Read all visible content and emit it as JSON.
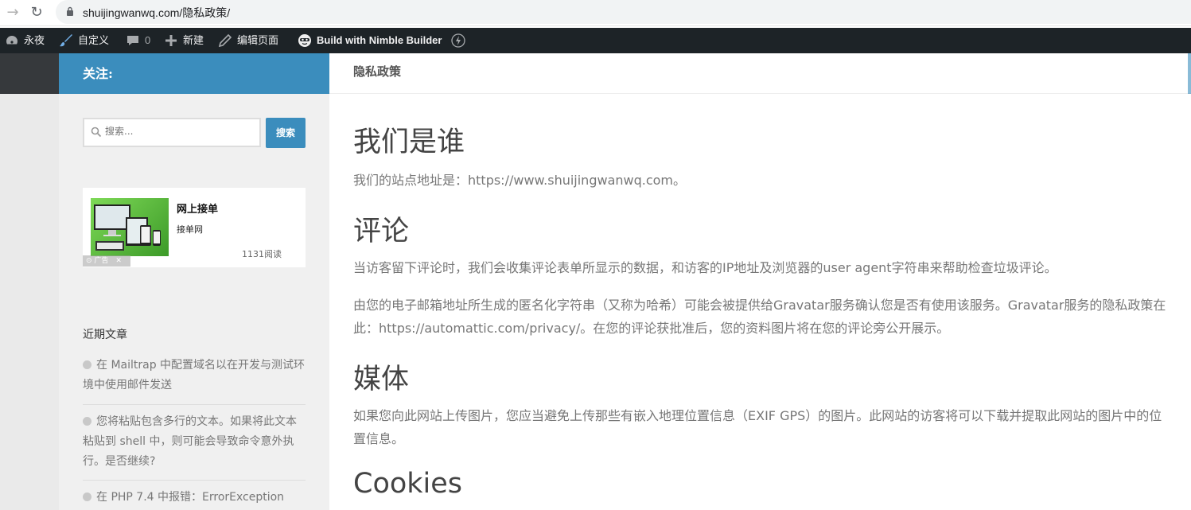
{
  "browser": {
    "url": "shuijingwanwq.com/隐私政策/"
  },
  "adminbar": {
    "site_name": "永夜",
    "customize": "自定义",
    "comments_count": "0",
    "new": "新建",
    "edit_page": "编辑页面",
    "nimble": "Build with Nimble Builder"
  },
  "sidebar": {
    "follow_label": "关注:",
    "search": {
      "placeholder": "搜索...",
      "button": "搜索"
    },
    "ad": {
      "title": "网上接单",
      "subtitle": "接单网",
      "reads": "1131阅读",
      "badge": "广告"
    },
    "recent_title": "近期文章",
    "recent_posts": [
      "在 Mailtrap 中配置域名以在开发与测试环境中使用邮件发送",
      "您将粘贴包含多行的文本。如果将此文本粘贴到 shell 中，则可能会导致命令意外执行。是否继续?",
      "在 PHP 7.4 中报错：ErrorException"
    ]
  },
  "main": {
    "page_title": "隐私政策",
    "sections": [
      {
        "heading": "我们是谁",
        "paragraphs": [
          "我们的站点地址是：https://www.shuijingwanwq.com。"
        ]
      },
      {
        "heading": "评论",
        "paragraphs": [
          "当访客留下评论时，我们会收集评论表单所显示的数据，和访客的IP地址及浏览器的user agent字符串来帮助检查垃圾评论。",
          "由您的电子邮箱地址所生成的匿名化字符串（又称为哈希）可能会被提供给Gravatar服务确认您是否有使用该服务。Gravatar服务的隐私政策在此：https://automattic.com/privacy/。在您的评论获批准后，您的资料图片将在您的评论旁公开展示。"
        ]
      },
      {
        "heading": "媒体",
        "paragraphs": [
          "如果您向此网站上传图片，您应当避免上传那些有嵌入地理位置信息（EXIF GPS）的图片。此网站的访客将可以下载并提取此网站的图片中的位置信息。"
        ]
      },
      {
        "heading": "Cookies",
        "paragraphs": []
      }
    ]
  },
  "colors": {
    "accent": "#3b8dbd",
    "adminbar": "#1d2327"
  }
}
